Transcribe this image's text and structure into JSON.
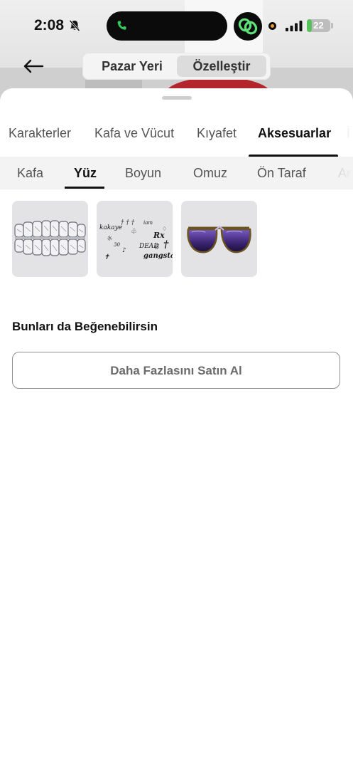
{
  "status_bar": {
    "time": "2:08",
    "battery": "22",
    "battery_level": 0.22
  },
  "header": {
    "segments": [
      {
        "label": "Pazar Yeri",
        "selected": false
      },
      {
        "label": "Özelleştir",
        "selected": true
      }
    ]
  },
  "category_tabs": [
    {
      "label": "Karakterler",
      "active": false
    },
    {
      "label": "Kafa ve Vücut",
      "active": false
    },
    {
      "label": "Kıyafet",
      "active": false
    },
    {
      "label": "Aksesuarlar",
      "active": true
    },
    {
      "label": "İ",
      "active": false
    }
  ],
  "subcategory_tabs": [
    {
      "label": "Kafa",
      "active": false
    },
    {
      "label": "Yüz",
      "active": true
    },
    {
      "label": "Boyun",
      "active": false
    },
    {
      "label": "Omuz",
      "active": false
    },
    {
      "label": "Ön Taraf",
      "active": false
    },
    {
      "label": "Ar",
      "active": false
    }
  ],
  "items": [
    {
      "icon": "diamond-grillz"
    },
    {
      "icon": "face-tattoos"
    },
    {
      "icon": "purple-sunglasses"
    }
  ],
  "tattoo_words": [
    "kakaye",
    "DEAD",
    "gangsta",
    "Rx",
    "iam"
  ],
  "recommendations": {
    "title": "Bunları da Beğenebilirsin",
    "buy_more_label": "Daha Fazlasını Satın Al"
  },
  "colors": {
    "accent": "#111111",
    "battery": "#56c25b",
    "call_green": "#34c759",
    "app_green": "#5de07a"
  }
}
